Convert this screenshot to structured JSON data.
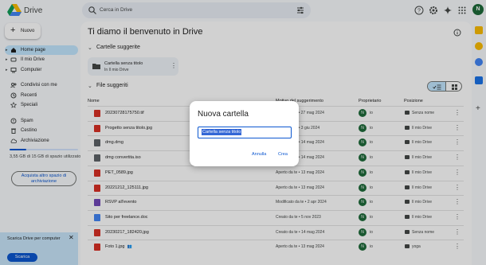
{
  "app": {
    "title": "Drive"
  },
  "search": {
    "placeholder": "Cerca in Drive"
  },
  "user": {
    "initial": "N"
  },
  "sidebar": {
    "new_label": "Nuovo",
    "items": [
      {
        "label": "Home page",
        "icon": "home-icon",
        "active": true
      },
      {
        "label": "Il mio Drive",
        "icon": "drive-icon"
      },
      {
        "label": "Computer",
        "icon": "computer-icon"
      },
      {
        "label": "Condivisi con me",
        "icon": "people-icon"
      },
      {
        "label": "Recenti",
        "icon": "clock-icon"
      },
      {
        "label": "Speciali",
        "icon": "star-icon"
      },
      {
        "label": "Spam",
        "icon": "spam-icon"
      },
      {
        "label": "Cestino",
        "icon": "trash-icon"
      },
      {
        "label": "Archiviazione",
        "icon": "cloud-icon"
      }
    ],
    "storage_text": "3,55 GB di 15 GB di spazio utilizzato",
    "storage_fraction": 0.24,
    "storage_button": "Acquista altro spazio di archiviazione"
  },
  "promo": {
    "text": "Scarica Drive per computer",
    "button": "Scarica"
  },
  "main": {
    "welcome": "Ti diamo il benvenuto in Drive",
    "suggested_folders_title": "Cartelle suggerite",
    "folder_card": {
      "name": "Cartella senza titolo",
      "location": "In Il mio Drive"
    },
    "suggested_files_title": "File suggeriti",
    "columns": {
      "name": "Nome",
      "reason": "Motivo del suggerimento",
      "owner": "Proprietario",
      "location": "Posizione"
    },
    "rows": [
      {
        "name": "20230728175750.tif",
        "reason": "Aperto da te • 27 mag 2024",
        "owner": "io",
        "location": "Senza nome",
        "color": "#d93025"
      },
      {
        "name": "Progetto senza titolo.jpg",
        "reason": "Aperto da te • 3 giu 2024",
        "owner": "io",
        "location": "Il mio Drive",
        "color": "#d93025"
      },
      {
        "name": "dmg.dmg",
        "reason": "Aperto da te • 14 mag 2024",
        "owner": "io",
        "location": "Il mio Drive",
        "color": "#5f6368"
      },
      {
        "name": "dmg convertita.iso",
        "reason": "Aperto da te • 14 mag 2024",
        "owner": "io",
        "location": "Il mio Drive",
        "color": "#5f6368"
      },
      {
        "name": "PET_0589.jpg",
        "reason": "Aperto da te • 13 mag 2024",
        "owner": "io",
        "location": "Il mio Drive",
        "color": "#d93025"
      },
      {
        "name": "20221212_125111.jpg",
        "reason": "Aperto da te • 13 mag 2024",
        "owner": "io",
        "location": "Il mio Drive",
        "color": "#d93025"
      },
      {
        "name": "RSVP all'evento",
        "reason": "Modificato da te • 2 apr 2024",
        "owner": "io",
        "location": "Il mio Drive",
        "color": "#7248b9"
      },
      {
        "name": "Sito per freelance.doc",
        "reason": "Creato da te • 5 nov 2023",
        "owner": "io",
        "location": "Il mio Drive",
        "color": "#4285f4"
      },
      {
        "name": "20230217_182420.jpg",
        "reason": "Creato da te • 14 mag 2024",
        "owner": "io",
        "location": "Senza nome",
        "color": "#d93025"
      },
      {
        "name": "Foto 1.jpg",
        "reason": "Aperto da te • 13 mag 2024",
        "owner": "io",
        "location": "yoga",
        "color": "#d93025",
        "shared": true
      }
    ]
  },
  "dialog": {
    "title": "Nuova cartella",
    "value": "Cartella senza titolo",
    "cancel": "Annulla",
    "create": "Crea"
  }
}
